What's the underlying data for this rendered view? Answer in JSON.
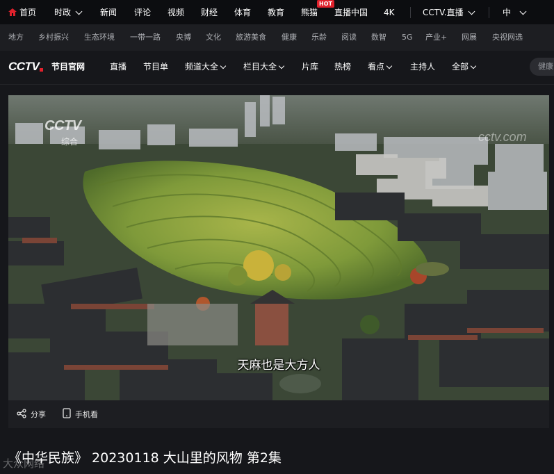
{
  "top_nav": {
    "items": [
      "首页",
      "时政",
      "新闻",
      "评论",
      "视频",
      "财经",
      "体育",
      "教育",
      "熊猫",
      "直播中国",
      "4K",
      "CCTV.直播",
      "中"
    ],
    "hot_badge": "HOT"
  },
  "sub_nav": {
    "items": [
      "地方",
      "乡村振兴",
      "生态环境",
      "一带一路",
      "央博",
      "文化",
      "旅游美食",
      "健康",
      "乐龄",
      "阅读",
      "数智",
      "5G",
      "产业+",
      "网展",
      "央视网选"
    ]
  },
  "main_nav": {
    "logo": "CCTV",
    "logo_sub": "节目官网",
    "items": [
      "直播",
      "节目单",
      "频道大全",
      "栏目大全",
      "片库",
      "热榜",
      "看点",
      "主持人",
      "全部"
    ],
    "search_placeholder": "健康"
  },
  "player": {
    "watermark_logo": "CCTV",
    "watermark_channel": "综合",
    "watermark_right": "cctv.com",
    "subtitle": "天麻也是大方人"
  },
  "actions": {
    "share": "分享",
    "mobile": "手机看"
  },
  "video_title": "《中华民族》 20230118 大山里的风物 第2集",
  "corner_watermark": "大众网络",
  "colors": {
    "accent_red": "#e0212c",
    "page_bg": "#16171b"
  }
}
